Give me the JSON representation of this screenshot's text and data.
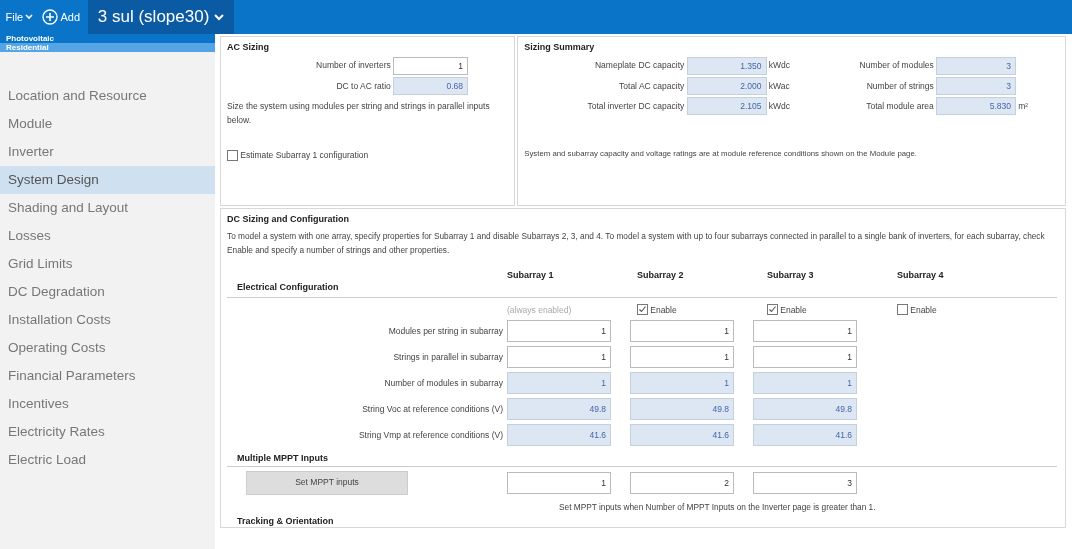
{
  "toolbar": {
    "file_menu": "File",
    "add_button": "Add",
    "case_selector": "3 sul (slope30)"
  },
  "sidebar": {
    "technology": "Photovoltaic",
    "market": "Residential",
    "items": [
      {
        "label": "Location and Resource",
        "selected": false
      },
      {
        "label": "Module",
        "selected": false
      },
      {
        "label": "Inverter",
        "selected": false
      },
      {
        "label": "System Design",
        "selected": true
      },
      {
        "label": "Shading and Layout",
        "selected": false
      },
      {
        "label": "Losses",
        "selected": false
      },
      {
        "label": "Grid Limits",
        "selected": false
      },
      {
        "label": "DC Degradation",
        "selected": false
      },
      {
        "label": "Installation Costs",
        "selected": false
      },
      {
        "label": "Operating Costs",
        "selected": false
      },
      {
        "label": "Financial Parameters",
        "selected": false
      },
      {
        "label": "Incentives",
        "selected": false
      },
      {
        "label": "Electricity Rates",
        "selected": false
      },
      {
        "label": "Electric Load",
        "selected": false
      }
    ]
  },
  "ac_sizing": {
    "title": "AC Sizing",
    "fields": [
      {
        "label": "Number of inverters",
        "value": "1",
        "readonly": false
      },
      {
        "label": "DC to AC ratio",
        "value": "0.68",
        "readonly": true
      }
    ],
    "note": "Size the system using modules per string and strings in parallel inputs below.",
    "estimate_checkbox": {
      "label": "Estimate Subarray 1 configuration",
      "checked": false
    }
  },
  "sizing_summary": {
    "title": "Sizing Summary",
    "left": [
      {
        "label": "Nameplate DC capacity",
        "value": "1.350",
        "unit": "kWdc"
      },
      {
        "label": "Total AC capacity",
        "value": "2.000",
        "unit": "kWac"
      },
      {
        "label": "Total inverter DC capacity",
        "value": "2.105",
        "unit": "kWdc"
      }
    ],
    "right": [
      {
        "label": "Number of modules",
        "value": "3"
      },
      {
        "label": "Number of strings",
        "value": "3"
      },
      {
        "label": "Total module area",
        "value": "5.830",
        "unit": "m²"
      }
    ],
    "note": "System and subarray capacity and voltage ratings are at module reference conditions shown on the Module page."
  },
  "dc_sizing": {
    "title": "DC Sizing and Configuration",
    "description": "To model a system with one array, specify properties for Subarray 1 and disable Subarrays 2, 3, and 4.  To model a system with up to four subarrays connected in parallel to a single bank of inverters, for each subarray, check Enable and specify a number of strings and other properties.",
    "electrical_title": "Electrical Configuration",
    "subarrays": [
      "Subarray 1",
      "Subarray 2",
      "Subarray 3",
      "Subarray 4"
    ],
    "enable": [
      {
        "kind": "note",
        "label": "(always enabled)"
      },
      {
        "kind": "checkbox",
        "label": "Enable",
        "checked": true
      },
      {
        "kind": "checkbox",
        "label": "Enable",
        "checked": true
      },
      {
        "kind": "checkbox",
        "label": "Enable",
        "checked": false
      }
    ],
    "rows": [
      {
        "label": "Modules per string in subarray",
        "readonly": false,
        "values": [
          "1",
          "1",
          "1"
        ]
      },
      {
        "label": "Strings in parallel in subarray",
        "readonly": false,
        "values": [
          "1",
          "1",
          "1"
        ]
      },
      {
        "label": "Number of modules in subarray",
        "readonly": true,
        "values": [
          "1",
          "1",
          "1"
        ]
      },
      {
        "label": "String Voc at reference conditions (V)",
        "readonly": true,
        "values": [
          "49.8",
          "49.8",
          "49.8"
        ]
      },
      {
        "label": "String Vmp at reference conditions (V)",
        "readonly": true,
        "values": [
          "41.6",
          "41.6",
          "41.6"
        ]
      }
    ],
    "mppt_title": "Multiple MPPT Inputs",
    "mppt_button": "Set MPPT inputs",
    "mppt_values": [
      "1",
      "2",
      "3"
    ],
    "mppt_note": "Set MPPT inputs when Number of MPPT Inputs on the Inverter page is greater than 1.",
    "next_section": "Tracking & Orientation"
  }
}
